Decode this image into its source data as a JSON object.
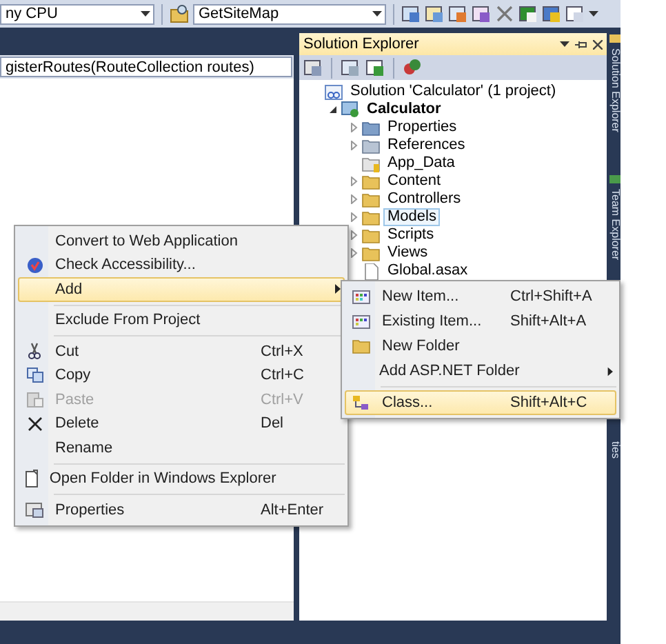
{
  "toolbar": {
    "platform_combo": {
      "value": "ny CPU"
    },
    "target_combo": {
      "value": "GetSiteMap"
    }
  },
  "editor": {
    "member_combo": {
      "value": "gisterRoutes(RouteCollection routes)"
    }
  },
  "solution_explorer": {
    "title": "Solution Explorer",
    "tree": [
      {
        "label": "Solution 'Calculator' (1 project)",
        "kind": "solution",
        "selected": false,
        "children": [
          {
            "label": "Calculator",
            "kind": "project",
            "expanded": true,
            "selected": false,
            "children": [
              {
                "label": "Properties",
                "kind": "properties",
                "expanded": false,
                "selected": false
              },
              {
                "label": "References",
                "kind": "references",
                "expanded": false,
                "selected": false
              },
              {
                "label": "App_Data",
                "kind": "data",
                "selected": false
              },
              {
                "label": "Content",
                "kind": "folder",
                "expanded": false,
                "selected": false
              },
              {
                "label": "Controllers",
                "kind": "folder",
                "expanded": false,
                "selected": false
              },
              {
                "label": "Models",
                "kind": "folder",
                "expanded": false,
                "selected": true
              },
              {
                "label": "Scripts",
                "kind": "folder",
                "expanded": false,
                "selected": false
              },
              {
                "label": "Views",
                "kind": "folder",
                "expanded": false,
                "selected": false
              },
              {
                "label": "Global.asax",
                "kind": "file",
                "selected": false
              }
            ]
          }
        ]
      }
    ]
  },
  "side_tabs": [
    {
      "label": "Solution Explorer"
    },
    {
      "label": "Team Explorer"
    },
    {
      "label": "ties"
    }
  ],
  "context_menu": [
    {
      "kind": "item",
      "label": "Convert to Web Application",
      "selected": false,
      "disabled": false
    },
    {
      "kind": "item",
      "label": "Check Accessibility...",
      "selected": false,
      "disabled": false
    },
    {
      "kind": "item",
      "label": "Add",
      "selected": true,
      "disabled": false,
      "submenu": true
    },
    {
      "kind": "separator"
    },
    {
      "kind": "item",
      "label": "Exclude From Project",
      "selected": false,
      "disabled": false
    },
    {
      "kind": "separator"
    },
    {
      "kind": "item",
      "label": "Cut",
      "shortcut": "Ctrl+X",
      "selected": false,
      "disabled": false
    },
    {
      "kind": "item",
      "label": "Copy",
      "shortcut": "Ctrl+C",
      "selected": false,
      "disabled": false
    },
    {
      "kind": "item",
      "label": "Paste",
      "shortcut": "Ctrl+V",
      "selected": false,
      "disabled": true
    },
    {
      "kind": "item",
      "label": "Delete",
      "shortcut": "Del",
      "selected": false,
      "disabled": false
    },
    {
      "kind": "item",
      "label": "Rename",
      "selected": false,
      "disabled": false
    },
    {
      "kind": "separator"
    },
    {
      "kind": "item",
      "label": "Open Folder in Windows Explorer",
      "selected": false,
      "disabled": false
    },
    {
      "kind": "separator"
    },
    {
      "kind": "item",
      "label": "Properties",
      "shortcut": "Alt+Enter",
      "selected": false,
      "disabled": false
    }
  ],
  "add_submenu": [
    {
      "kind": "item",
      "label": "New Item...",
      "shortcut": "Ctrl+Shift+A",
      "selected": false,
      "disabled": false
    },
    {
      "kind": "item",
      "label": "Existing Item...",
      "shortcut": "Shift+Alt+A",
      "selected": false,
      "disabled": false
    },
    {
      "kind": "item",
      "label": "New Folder",
      "selected": false,
      "disabled": false
    },
    {
      "kind": "item",
      "label": "Add ASP.NET Folder",
      "selected": false,
      "disabled": false,
      "submenu": true
    },
    {
      "kind": "separator"
    },
    {
      "kind": "item",
      "label": "Class...",
      "shortcut": "Shift+Alt+C",
      "selected": true,
      "disabled": false
    }
  ]
}
